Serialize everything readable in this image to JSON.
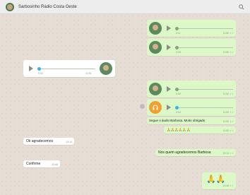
{
  "header": {
    "title": "Sarbosinho Rádio Costa Oeste"
  },
  "messages": {
    "a1": {
      "duration": "0:11",
      "time": "11:50 ✓✓"
    },
    "a2": {
      "duration": "0:08",
      "time": "11:50 ✓✓"
    },
    "a3": {
      "duration": "0:32",
      "time": "11:51"
    },
    "a4": {
      "duration": "0:09",
      "time": "11:52 ✓✓"
    },
    "a5": {
      "duration": "0:04",
      "time": "11:52 ✓✓"
    },
    "t1": {
      "text": "Segue o áudio Barbosa. Muito obrigado",
      "time": "11:52 ✓✓"
    },
    "t2": {
      "text": "🙏🙏🙏🙏🙏🙏",
      "time": "11:52 ✓✓"
    },
    "t3": {
      "text": "Ok agradecemos",
      "time": "13:14"
    },
    "t4": {
      "text": "Nós quem agradecemos Barbosa",
      "time": "13:14 ✓✓"
    },
    "t5": {
      "text": "Confirme",
      "time": "13:46"
    },
    "t6": {
      "text": "🙏🙏",
      "time": "13:46 ✓✓"
    }
  }
}
